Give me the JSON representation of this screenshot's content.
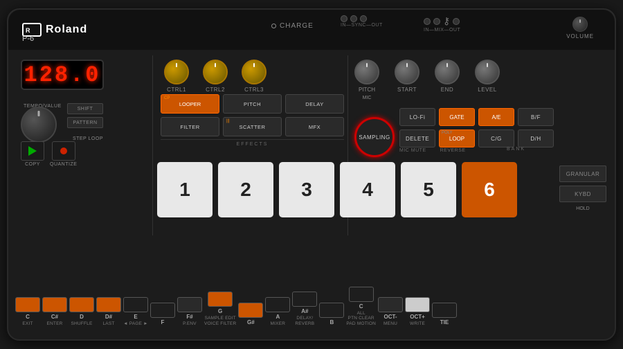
{
  "device": {
    "brand": "Roland",
    "model": "P-6",
    "charge_label": "CHARGE",
    "volume_label": "VOLUME",
    "display_value": "128.0",
    "connectors": {
      "group1_label": "IN—SYNC—OUT",
      "group2_label": "IN—MIX—OUT"
    }
  },
  "controls": {
    "knobs": {
      "ctrl1": "CTRL1",
      "ctrl2": "CTRL2",
      "ctrl3": "CTRL3",
      "pitch": "PITCH",
      "start": "START",
      "end": "END",
      "level": "LEVEL",
      "tempo": "TEMPO/VALUE"
    },
    "effects_buttons": [
      {
        "label": "LOOPER",
        "sub": "CP",
        "type": "orange"
      },
      {
        "label": "PITCH",
        "sub": "",
        "type": "dark"
      },
      {
        "label": "DELAY",
        "sub": "",
        "type": "dark"
      },
      {
        "label": "FILTER",
        "sub": "",
        "type": "dark"
      },
      {
        "label": "SCATTER",
        "sub": "|||",
        "type": "dark"
      },
      {
        "label": "MFX",
        "sub": "",
        "type": "dark"
      }
    ],
    "effects_section_label": "EFFECTS",
    "shift_label": "SHIFT",
    "pattern_label": "PATTERN",
    "step_loop_label": "STEP LOOP",
    "copy_label": "COPY",
    "quantize_label": "QUANTIZE"
  },
  "right_buttons": [
    {
      "label": "LO-Fi",
      "type": "dark",
      "sub": ""
    },
    {
      "label": "GATE",
      "type": "orange",
      "sub": ""
    },
    {
      "label": "A/E",
      "type": "orange",
      "sub": ""
    },
    {
      "label": "B/F",
      "type": "dark",
      "sub": ""
    },
    {
      "label": "DELETE",
      "type": "dark",
      "sub": ""
    },
    {
      "label": "LOOP",
      "type": "orange",
      "sub": "POLY"
    },
    {
      "label": "C/G",
      "type": "dark",
      "sub": ""
    },
    {
      "label": "D/H",
      "type": "dark",
      "sub": ""
    }
  ],
  "sampling_btn_label": "SAMPLING",
  "mic_label": "MIC",
  "bank_label": "BANK",
  "mic_mute_label": "MIC MUTE",
  "reverse_label": "REVERSE",
  "pads": [
    {
      "number": "1",
      "type": "white"
    },
    {
      "number": "2",
      "type": "white"
    },
    {
      "number": "3",
      "type": "white"
    },
    {
      "number": "4",
      "type": "white"
    },
    {
      "number": "5",
      "type": "white"
    },
    {
      "number": "6",
      "type": "orange"
    }
  ],
  "side_buttons": [
    {
      "label": "GRANULAR"
    },
    {
      "label": "KYBD"
    },
    {
      "label": "HOLD"
    }
  ],
  "bottom_pads": [
    {
      "note": "C",
      "label": "EXIT",
      "type": "orange"
    },
    {
      "note": "C#",
      "label": "ENTER",
      "type": "orange"
    },
    {
      "note": "D",
      "label": "SHUFFLE",
      "type": "orange"
    },
    {
      "note": "D#",
      "label": "LAST",
      "type": "orange"
    },
    {
      "note": "E",
      "label": "◄ PAGE ►",
      "type": "dark"
    },
    {
      "note": "F",
      "label": "",
      "type": "dark"
    },
    {
      "note": "F#",
      "label": "P.ENV",
      "type": "dim"
    },
    {
      "note": "G",
      "label": "SAMPLE EDIT\nVOICE FILTER",
      "type": "orange"
    },
    {
      "note": "G#",
      "label": "",
      "type": "orange"
    },
    {
      "note": "A",
      "label": "MIXER",
      "type": "dark"
    },
    {
      "note": "A#",
      "label": "DELAY/\nREVERB",
      "type": "dark"
    },
    {
      "note": "B",
      "label": "",
      "type": "dark"
    },
    {
      "note": "C2",
      "label": "ALL\nPTN CLEAR\nPAD MOTION",
      "type": "dark"
    },
    {
      "note": "OCT-",
      "label": "MENU",
      "type": "dim"
    },
    {
      "note": "OCT+",
      "label": "WRITE",
      "type": "white"
    },
    {
      "note": "TIE",
      "label": "",
      "type": "dark"
    }
  ]
}
